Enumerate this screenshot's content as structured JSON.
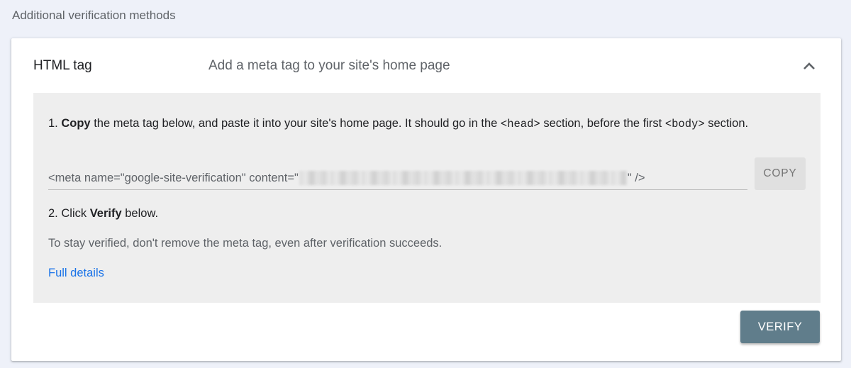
{
  "section_heading": "Additional verification methods",
  "method": {
    "title": "HTML tag",
    "description": "Add a meta tag to your site's home page",
    "collapse_icon": "chevron-up-icon"
  },
  "step1": {
    "number": "1.",
    "bold": "Copy",
    "text_a": "the meta tag below, and paste it into your site's home page. It should go in the",
    "code_head": "<head>",
    "text_b": "section, before the first",
    "code_body": "<body>",
    "text_c": "section."
  },
  "meta_tag": {
    "prefix": "<meta name=\"google-site-verification\" content=\"",
    "suffix": "\" />",
    "token_redacted": true
  },
  "copy_label": "COPY",
  "step2": {
    "number": "2.",
    "text_a": "Click",
    "bold": "Verify",
    "text_b": "below."
  },
  "note": "To stay verified, don't remove the meta tag, even after verification succeeds.",
  "full_details_link": "Full details",
  "verify_label": "VERIFY",
  "colors": {
    "background": "#eef1f9",
    "panel": "#eeeeee",
    "verify_button": "#607d8b",
    "link": "#1a73e8"
  }
}
